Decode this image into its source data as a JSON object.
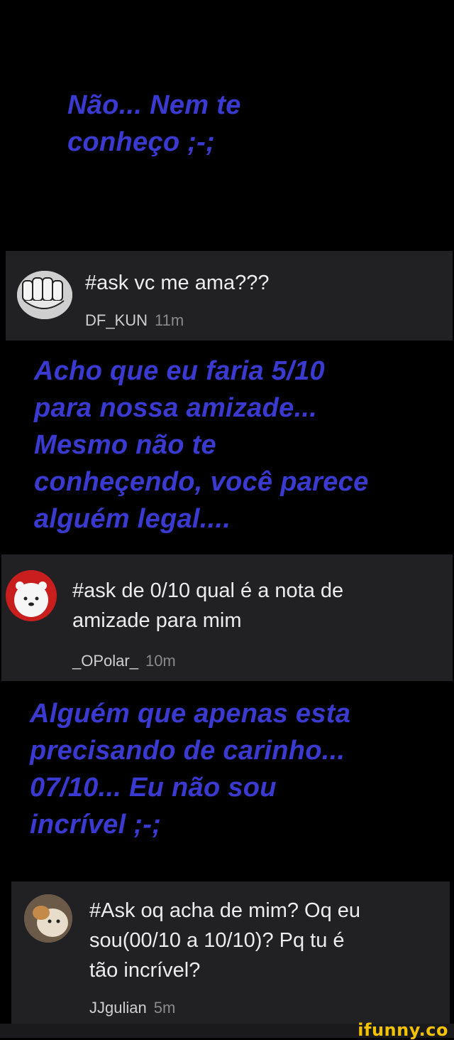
{
  "answers": [
    {
      "text": "Não... Nem te\nconheço ;-;"
    },
    {
      "text": "Acho que eu faria 5/10\npara nossa amizade...\nMesmo não te\nconheçendo, você parece\nalguém legal...."
    },
    {
      "text": "Alguém que apenas esta\nprecisando de carinho...\n07/10... Eu não sou\nincrível ;-;"
    }
  ],
  "questions": [
    {
      "text": "#ask vc me ama???",
      "user": "DF_KUN",
      "time": "11m"
    },
    {
      "text": "#ask de 0/10 qual é a nota de\namizade para mim",
      "user": "_OPolar_",
      "time": "10m"
    },
    {
      "text": "#Ask oq acha de mim? Oq eu\nsou(00/10 a 10/10)? Pq tu é\ntão incrível?",
      "user": "JJgulian",
      "time": "5m"
    }
  ],
  "watermark": "ifunny.co",
  "colors": {
    "answer": "#3a3ad0",
    "card": "#212124",
    "watermark": "#f2c200"
  }
}
